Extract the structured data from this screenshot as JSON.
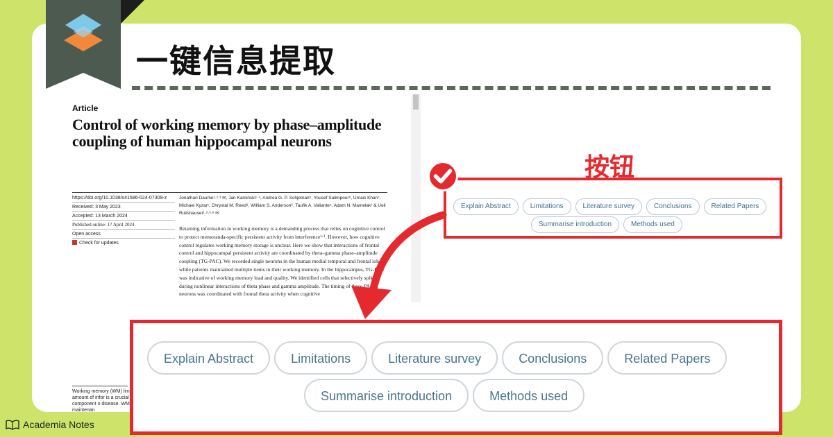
{
  "headline": "一键信息提取",
  "annotation": {
    "button_label": "按钮"
  },
  "article": {
    "label": "Article",
    "title": "Control of working memory by phase–amplitude coupling of human hippocampal neurons",
    "meta": [
      "https://doi.org/10.1038/s41586-024-07309-z",
      "Received: 3 May 2023",
      "Accepted: 13 March 2024",
      "Published online: 17 April 2024",
      "Open access",
      "Check for updates"
    ],
    "authors": "Jonathan Daume¹·²·³ ✉, Jan Kamiński¹·⁴, Andrea G. P. Schjetnan⁵, Yousef Salimpour⁶, Umais Khan⁷, Michael Kyzar¹, Chrystal M. Reed⁸, William S. Anderson⁶, Taufik A. Valiante⁵, Adam N. Mamelak¹ & Ueli Rutishauser¹·²·³·⁸ ✉",
    "abstract": "Retaining information in working memory is a demanding process that relies on cognitive control to protect memoranda-specific persistent activity from interference¹·². However, how cognitive control regulates working memory storage is unclear. Here we show that interactions of frontal control and hippocampal persistent activity are coordinated by theta–gamma phase–amplitude coupling (TG-PAC). We recorded single neurons in the human medial temporal and frontal lobe while patients maintained multiple items in their working memory. In the hippocampus, TG-PAC was indicative of working memory load and quality. We identified cells that selectively spiked during nonlinear interactions of theta phase and gamma amplitude. The timing of these PAC neurons was coordinated with frontal theta activity when cognitive",
    "footer": "Working memory (WM) limited amount of infor is a crucial component o disease. WM maintenan"
  },
  "actions": {
    "row1": [
      "Explain Abstract",
      "Limitations",
      "Literature survey",
      "Conclusions",
      "Related Papers"
    ],
    "row2": [
      "Summarise introduction",
      "Methods used"
    ]
  },
  "brand": {
    "name": "Academia Notes"
  },
  "colors": {
    "background": "#cde36a",
    "accent_red": "#e52a2f",
    "chip_text": "#3f6f8d",
    "bookmark": "#4d5a4f"
  }
}
